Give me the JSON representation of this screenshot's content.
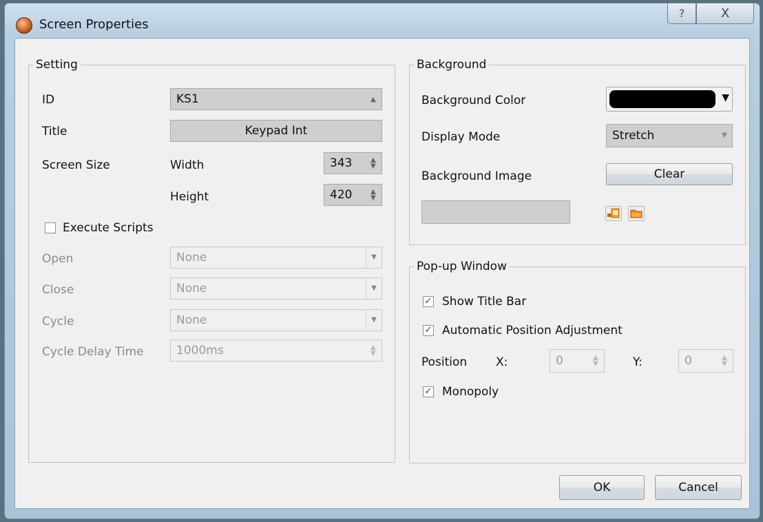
{
  "window": {
    "title": "Screen Properties",
    "help": "?",
    "close": "X"
  },
  "setting": {
    "legend": "Setting",
    "id_label": "ID",
    "id_value": "KS1",
    "title_label": "Title",
    "title_value": "Keypad Int",
    "size_label": "Screen Size",
    "width_label": "Width",
    "width_value": "343",
    "height_label": "Height",
    "height_value": "420",
    "execute_label": "Execute Scripts",
    "execute_checked": false,
    "open_label": "Open",
    "open_value": "None",
    "close_label": "Close",
    "close_value": "None",
    "cycle_label": "Cycle",
    "cycle_value": "None",
    "delay_label": "Cycle Delay Time",
    "delay_value": "1000ms"
  },
  "background": {
    "legend": "Background",
    "color_label": "Background Color",
    "color_value": "#000000",
    "mode_label": "Display Mode",
    "mode_value": "Stretch",
    "image_label": "Background Image",
    "clear_label": "Clear",
    "path_value": ""
  },
  "popup": {
    "legend": "Pop-up Window",
    "show_title_label": "Show Title Bar",
    "show_title_checked": true,
    "auto_adjust_label": "Automatic Position Adjustment",
    "auto_adjust_checked": true,
    "position_label": "Position",
    "x_label": "X:",
    "x_value": "0",
    "y_label": "Y:",
    "y_value": "0",
    "monopoly_label": "Monopoly",
    "monopoly_checked": true
  },
  "footer": {
    "ok": "OK",
    "cancel": "Cancel"
  }
}
